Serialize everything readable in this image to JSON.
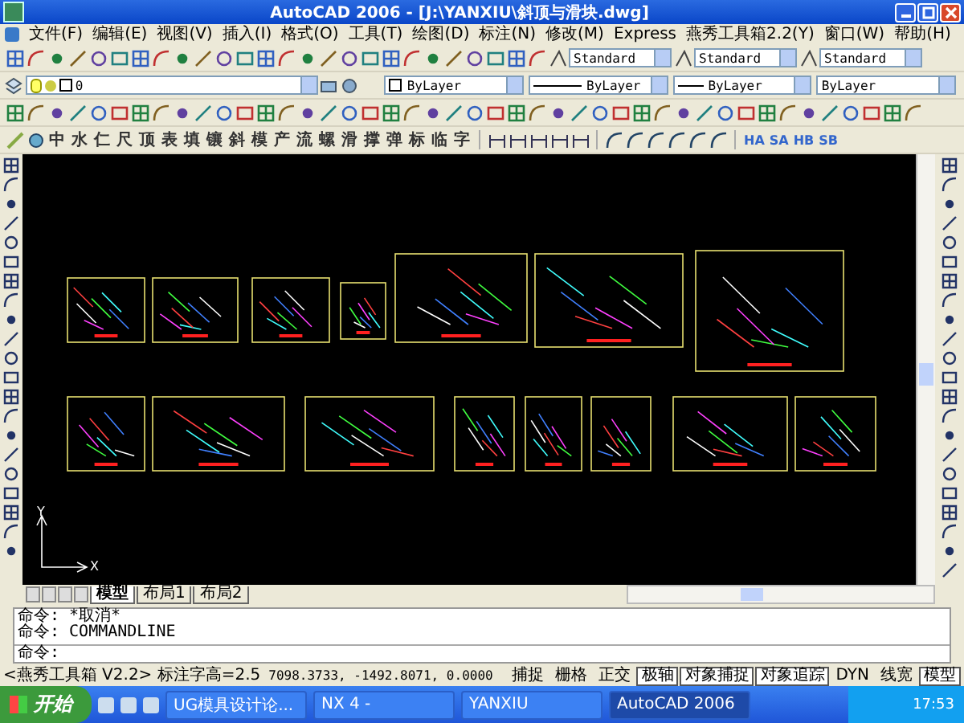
{
  "window": {
    "title": "AutoCAD 2006 - [J:\\YANXIU\\斜顶与滑块.dwg]"
  },
  "menu": [
    "文件(F)",
    "编辑(E)",
    "视图(V)",
    "插入(I)",
    "格式(O)",
    "工具(T)",
    "绘图(D)",
    "标注(N)",
    "修改(M)",
    "Express",
    "燕秀工具箱2.2(Y)",
    "窗口(W)",
    "帮助(H)"
  ],
  "style_dropdowns": [
    {
      "value": "Standard"
    },
    {
      "value": "Standard"
    },
    {
      "value": "Standard"
    }
  ],
  "layer_toolbar": {
    "layer": "0",
    "properties": [
      {
        "kind": "color",
        "value": "ByLayer"
      },
      {
        "kind": "linetype",
        "value": "ByLayer"
      },
      {
        "kind": "lineweight",
        "value": "ByLayer"
      },
      {
        "kind": "plain",
        "value": "ByLayer"
      }
    ]
  },
  "char_toolbar": [
    "中",
    "水",
    "仁",
    "尺",
    "顶",
    "表",
    "填",
    "镶",
    "斜",
    "模",
    "产",
    "流",
    "螺",
    "滑",
    "撑",
    "弹",
    "标",
    "临",
    "字"
  ],
  "letter_toolbar": [
    "HA",
    "SA",
    "HB",
    "SB"
  ],
  "axis": {
    "x": "X",
    "y": "Y"
  },
  "layout_tabs": [
    {
      "label": "模型",
      "selected": true
    },
    {
      "label": "布局1",
      "selected": false
    },
    {
      "label": "布局2",
      "selected": false
    }
  ],
  "command": {
    "lines": [
      {
        "prompt": "命令:",
        "text": "*取消*"
      },
      {
        "prompt": "命令:",
        "text": "COMMANDLINE"
      }
    ],
    "prompt": "命令:"
  },
  "status_bar": {
    "toolkit": "<燕秀工具箱 V2.2> 标注字高=2.5",
    "coords": "7098.3733, -1492.8071, 0.0000",
    "toggles": [
      {
        "label": "捕捉",
        "on": false
      },
      {
        "label": "栅格",
        "on": false
      },
      {
        "label": "正交",
        "on": false
      },
      {
        "label": "极轴",
        "on": true
      },
      {
        "label": "对象捕捉",
        "on": true
      },
      {
        "label": "对象追踪",
        "on": true
      },
      {
        "label": "DYN",
        "on": false
      },
      {
        "label": "线宽",
        "on": false
      },
      {
        "label": "模型",
        "on": true
      }
    ]
  },
  "taskbar": {
    "start": "开始",
    "tasks": [
      {
        "label": "UG模具设计论...",
        "selected": false
      },
      {
        "label": "NX 4 -",
        "selected": false
      },
      {
        "label": "YANXIU",
        "selected": false
      },
      {
        "label": "AutoCAD 2006",
        "selected": true
      }
    ],
    "clock": "17:53"
  }
}
